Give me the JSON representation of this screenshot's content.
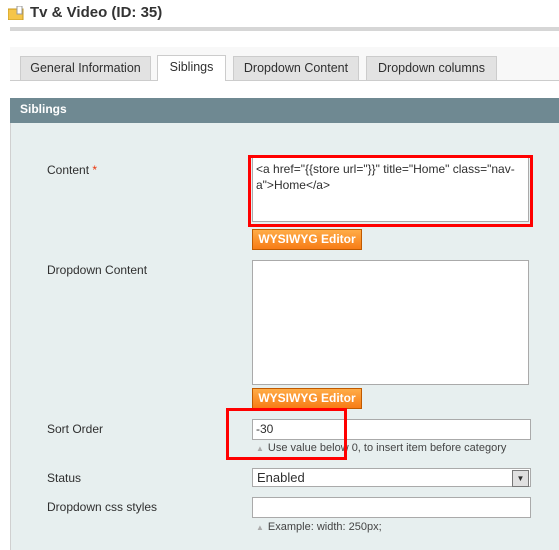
{
  "page": {
    "title": "Tv & Video (ID: 35)"
  },
  "tabs": [
    {
      "label": "General Information"
    },
    {
      "label": "Siblings",
      "active": true
    },
    {
      "label": "Dropdown Content"
    },
    {
      "label": "Dropdown columns"
    }
  ],
  "section": {
    "title": "Siblings"
  },
  "form": {
    "content": {
      "label": "Content",
      "required": "*",
      "value": "<a href=\"{{store url=\"}}\" title=\"Home\" class=\"nav-a\">Home</a>"
    },
    "wysiwyg_label": "WYSIWYG Editor",
    "dropdown_content": {
      "label": "Dropdown Content",
      "value": ""
    },
    "sort_order": {
      "label": "Sort Order",
      "value": "-30",
      "hint": "Use value below 0, to insert item before category"
    },
    "status": {
      "label": "Status",
      "value": "Enabled"
    },
    "css": {
      "label": "Dropdown css styles",
      "value": "",
      "hint": "Example: width: 250px;"
    }
  },
  "colors": {
    "header": "#6f8992",
    "panel": "#e7efef",
    "button": "#f77c16",
    "highlight": "#ff0000"
  }
}
